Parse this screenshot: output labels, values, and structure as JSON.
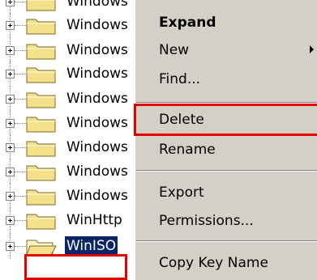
{
  "tree": {
    "items": [
      {
        "label": "Windows"
      },
      {
        "label": "Windows"
      },
      {
        "label": "Windows"
      },
      {
        "label": "Windows"
      },
      {
        "label": "Windows"
      },
      {
        "label": "Windows"
      },
      {
        "label": "Windows"
      },
      {
        "label": "Windows"
      },
      {
        "label": "Windows"
      },
      {
        "label": "WinHttp"
      },
      {
        "label": "WinISO"
      }
    ],
    "selected_index": 10
  },
  "context_menu": {
    "expand": "Expand",
    "new": "New",
    "find": "Find...",
    "delete": "Delete",
    "rename": "Rename",
    "export": "Export",
    "permissions": "Permissions...",
    "copy_key_name": "Copy Key Name"
  },
  "colors": {
    "highlight_box": "#e00000",
    "selection": "#0a246a",
    "menu_bg": "#d4d0c8",
    "folder": "#f4e08a"
  }
}
